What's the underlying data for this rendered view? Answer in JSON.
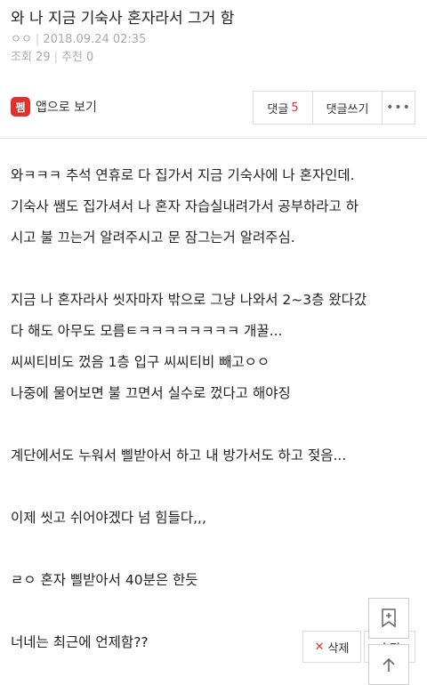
{
  "post": {
    "title": "와 나 지금 기숙사 혼자라서 그거 함",
    "author": "ㅇㅇ",
    "date": "2018.09.24 02:35",
    "views_label": "조회 29",
    "recommend_label": "추천 0"
  },
  "toolbar": {
    "app_logo_text": "펨",
    "app_view_label": "앱으로 보기",
    "comment_label": "댓글",
    "comment_count": "5",
    "write_comment_label": "댓글쓰기",
    "more_label": "•••"
  },
  "content": {
    "lines": [
      "와ㅋㅋㅋ 추석 연휴로 다 집가서 지금 기숙사에 나 혼자인데.",
      "기숙사 쌤도 집가셔서 나 혼자 자습실내려가서 공부하라고 하",
      "시고 불 끄는거 알려주시고 문 잠그는거 알려주심.",
      "",
      "지금 나 혼자라사 씻자마자 밖으로 그냥 나와서 2~3층 왔다갔",
      "다 해도 아무도 모름ㅌㅋㅋㅋㅋㅋㅋㅋㅋ 개꿀...",
      "씨씨티비도 껐음 1층 입구 씨씨티비 빼고ㅇㅇ",
      "나중에 물어보면 불 끄면서 실수로 껐다고 해야징",
      "",
      "계단에서도 누워서 삘받아서 하고 내 방가서도 하고 젖음...",
      "",
      "이제 씻고 쉬어야겠다 넘 힘들다,,,",
      "",
      "ㄹㅇ 혼자 삘받아서 40분은 한듯",
      "",
      "너네는 최근에 언제함??"
    ]
  },
  "actions": {
    "delete_label": "삭제",
    "edit_label": "수정"
  },
  "colors": {
    "accent": "#e0312c",
    "meta_text": "#aaaaaa",
    "border": "#dddddd"
  }
}
